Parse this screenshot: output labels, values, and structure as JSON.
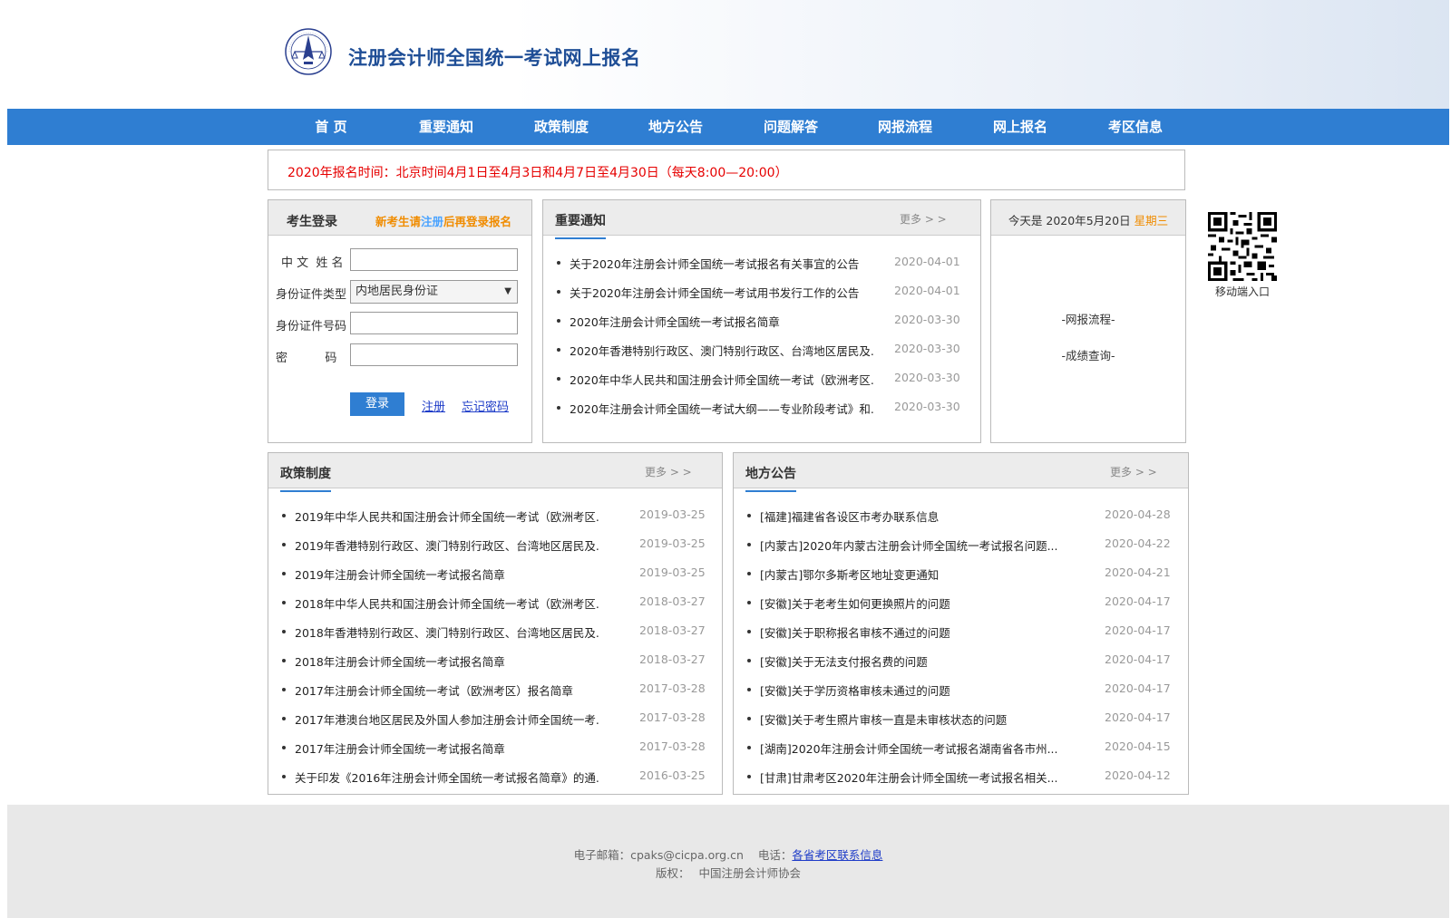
{
  "header": {
    "title": "注册会计师全国统一考试网上报名"
  },
  "nav": [
    {
      "label": "首 页"
    },
    {
      "label": "重要通知"
    },
    {
      "label": "政策制度"
    },
    {
      "label": "地方公告"
    },
    {
      "label": "问题解答"
    },
    {
      "label": "网报流程"
    },
    {
      "label": "网上报名"
    },
    {
      "label": "考区信息"
    }
  ],
  "notice": "2020年报名时间：北京时间4月1日至4月3日和4月7日至4月30日（每天8:00—20:00）",
  "login": {
    "title": "考生登录",
    "hint_prefix": "新考生请",
    "hint_link": "注册",
    "hint_suffix": "后再登录报名",
    "name_label": "中 文  姓 名",
    "id_type_label": "身份证件类型",
    "id_type_value": "内地居民身份证",
    "id_number_label": "身份证件号码",
    "password_label": "密          码",
    "submit": "登录",
    "register": "注册",
    "forgot": "忘记密码"
  },
  "important": {
    "title": "重要通知",
    "more": "更多 > >",
    "items": [
      {
        "text": "关于2020年注册会计师全国统一考试报名有关事宜的公告",
        "date": "2020-04-01"
      },
      {
        "text": "关于2020年注册会计师全国统一考试用书发行工作的公告",
        "date": "2020-04-01"
      },
      {
        "text": "2020年注册会计师全国统一考试报名简章",
        "date": "2020-03-30"
      },
      {
        "text": "2020年香港特别行政区、澳门特别行政区、台湾地区居民及...",
        "date": "2020-03-30"
      },
      {
        "text": "2020年中华人民共和国注册会计师全国统一考试（欧洲考区...",
        "date": "2020-03-30"
      },
      {
        "text": "2020年注册会计师全国统一考试大纲——专业阶段考试》和...",
        "date": "2020-03-30"
      }
    ]
  },
  "today": {
    "prefix": "今天是 2020年5月20日",
    "weekday": "星期三",
    "link1": "-网报流程-",
    "link2": "-成绩查询-"
  },
  "qr": {
    "label": "移动端入口"
  },
  "policy": {
    "title": "政策制度",
    "more": "更多 > >",
    "items": [
      {
        "text": "2019年中华人民共和国注册会计师全国统一考试（欧洲考区...",
        "date": "2019-03-25"
      },
      {
        "text": "2019年香港特别行政区、澳门特别行政区、台湾地区居民及...",
        "date": "2019-03-25"
      },
      {
        "text": "2019年注册会计师全国统一考试报名简章",
        "date": "2019-03-25"
      },
      {
        "text": "2018年中华人民共和国注册会计师全国统一考试（欧洲考区...",
        "date": "2018-03-27"
      },
      {
        "text": "2018年香港特别行政区、澳门特别行政区、台湾地区居民及...",
        "date": "2018-03-27"
      },
      {
        "text": "2018年注册会计师全国统一考试报名简章",
        "date": "2018-03-27"
      },
      {
        "text": "2017年注册会计师全国统一考试（欧洲考区）报名简章",
        "date": "2017-03-28"
      },
      {
        "text": "2017年港澳台地区居民及外国人参加注册会计师全国统一考...",
        "date": "2017-03-28"
      },
      {
        "text": "2017年注册会计师全国统一考试报名简章",
        "date": "2017-03-28"
      },
      {
        "text": "关于印发《2016年注册会计师全国统一考试报名简章》的通...",
        "date": "2016-03-25"
      }
    ]
  },
  "local": {
    "title": "地方公告",
    "more": "更多 > >",
    "items": [
      {
        "text": "[福建]福建省各设区市考办联系信息",
        "date": "2020-04-28"
      },
      {
        "text": "[内蒙古]2020年内蒙古注册会计师全国统一考试报名问题...",
        "date": "2020-04-22"
      },
      {
        "text": "[内蒙古]鄂尔多斯考区地址变更通知",
        "date": "2020-04-21"
      },
      {
        "text": "[安徽]关于老考生如何更换照片的问题",
        "date": "2020-04-17"
      },
      {
        "text": "[安徽]关于职称报名审核不通过的问题",
        "date": "2020-04-17"
      },
      {
        "text": "[安徽]关于无法支付报名费的问题",
        "date": "2020-04-17"
      },
      {
        "text": "[安徽]关于学历资格审核未通过的问题",
        "date": "2020-04-17"
      },
      {
        "text": "[安徽]关于考生照片审核一直是未审核状态的问题",
        "date": "2020-04-17"
      },
      {
        "text": "[湖南]2020年注册会计师全国统一考试报名湖南省各市州...",
        "date": "2020-04-15"
      },
      {
        "text": "[甘肃]甘肃考区2020年注册会计师全国统一考试报名相关...",
        "date": "2020-04-12"
      }
    ]
  },
  "footer": {
    "email_label": "电子邮箱：",
    "email": "cpaks@cicpa.org.cn",
    "phone_label": "电话：",
    "phone_link": "各省考区联系信息",
    "copyright_label": "版权：",
    "copyright": "中国注册会计师协会"
  },
  "colors": {
    "nav": "#2f7ed2",
    "notice": "#e60000",
    "accent": "#f08c00",
    "title": "#1f4e96"
  }
}
